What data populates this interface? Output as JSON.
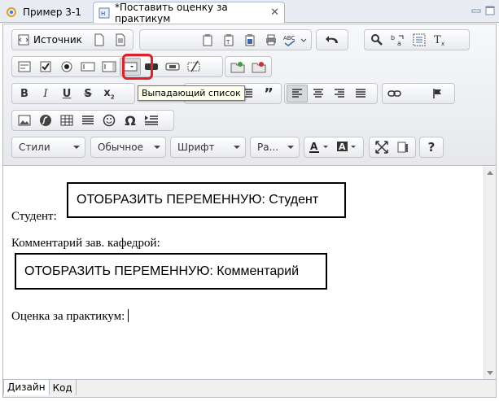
{
  "tabs": [
    {
      "label": "Пример 3-1",
      "icon": "project-icon"
    },
    {
      "label": "*Поставить оценку за практикум",
      "icon": "form-icon",
      "active": true
    }
  ],
  "toolbar": {
    "source_label": "Источник",
    "tooltip": "Выпадающий список",
    "combos": {
      "styles": "Стили",
      "format": "Обычное",
      "font": "Шрифт",
      "size": "Ра..."
    },
    "highlighted_button": "dropdown-list-button"
  },
  "content": {
    "student_label": "Студент:",
    "student_var": "ОТОБРАЗИТЬ ПЕРЕМЕННУЮ: Студент",
    "comment_label": "Комментарий зав. кафедрой:",
    "comment_var": "ОТОБРАЗИТЬ ПЕРЕМЕННУЮ: Комментарий",
    "grade_label": "Оценка за практикум:"
  },
  "bottom_tabs": [
    {
      "label": "Дизайн",
      "active": true
    },
    {
      "label": "Код"
    }
  ],
  "colors": {
    "highlight": "#e0202a",
    "tab_bg": "#e9edf3"
  }
}
